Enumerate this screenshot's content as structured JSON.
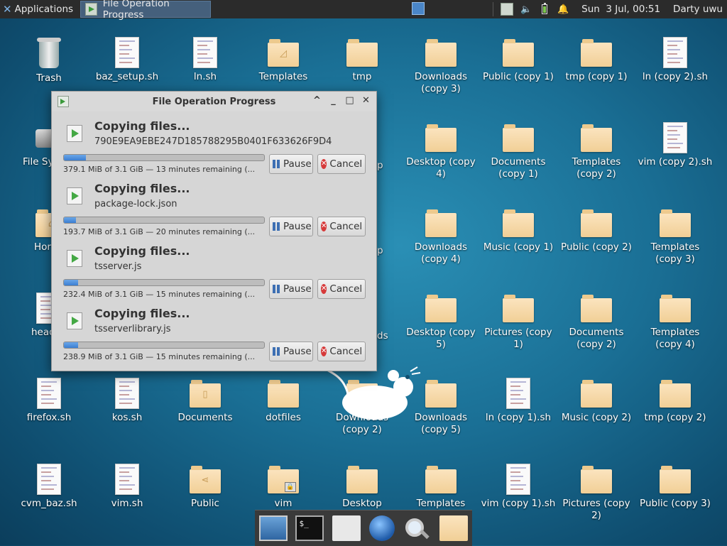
{
  "panel": {
    "applications_label": "Applications",
    "task_title": "File Operation Progress",
    "clock": "Sun  3 Jul, 00:51",
    "user": "Darty uwu"
  },
  "desktop": {
    "row1": [
      "Trash",
      "baz_setup.sh",
      "ln.sh",
      "Templates",
      "tmp",
      "Downloads (copy 3)",
      "Public (copy 1)",
      "tmp (copy 1)",
      "ln (copy 2).sh"
    ],
    "col1": [
      "File Sy",
      "Hor",
      "head",
      "firefox.sh",
      "cvm_baz.sh"
    ],
    "col2": [
      "kos.sh",
      "vim.sh"
    ],
    "col3": [
      "Documents",
      "Public"
    ],
    "col4": [
      "dotfiles",
      "vim"
    ],
    "col5": [
      "Downloads (copy 2)",
      "Desktop"
    ],
    "right_r2": [
      "Desktop (copy 4)",
      "Documents (copy 1)",
      "Templates (copy 2)",
      "vim (copy 2).sh"
    ],
    "right_r3": [
      "Downloads (copy 4)",
      "Music (copy 1)",
      "Public (copy 2)",
      "Templates (copy 3)"
    ],
    "right_r4": [
      "Desktop (copy 5)",
      "Pictures (copy 1)",
      "Documents (copy 2)",
      "Templates (copy 4)"
    ],
    "right_r5": [
      "Downloads (copy 5)",
      "ln (copy 1).sh",
      "Music (copy 2)",
      "tmp (copy 2)"
    ],
    "right_r6": [
      "Templates",
      "vim (copy 1).sh",
      "Pictures (copy 2)",
      "Public (copy 3)"
    ],
    "partial_behind_dialog": [
      "p",
      "p",
      "p",
      "ds",
      ")"
    ]
  },
  "dialog": {
    "title": "File Operation Progress",
    "pause_label": "Pause",
    "cancel_label": "Cancel",
    "operations": [
      {
        "heading": "Copying files...",
        "filename": "790E9EA9EBE247D185788295B0401F633626F9D4",
        "progress": 0.11,
        "status": "379.1 MiB of 3.1 GiB — 13 minutes remaining (..."
      },
      {
        "heading": "Copying files...",
        "filename": "package-lock.json",
        "progress": 0.06,
        "status": "193.7 MiB of 3.1 GiB — 20 minutes remaining (..."
      },
      {
        "heading": "Copying files...",
        "filename": "tsserver.js",
        "progress": 0.07,
        "status": "232.4 MiB of 3.1 GiB — 15 minutes remaining (..."
      },
      {
        "heading": "Copying files...",
        "filename": "tsserverlibrary.js",
        "progress": 0.07,
        "status": "238.9 MiB of 3.1 GiB — 15 minutes remaining (..."
      }
    ]
  },
  "dock": {
    "terminal_prompt": "$_"
  }
}
